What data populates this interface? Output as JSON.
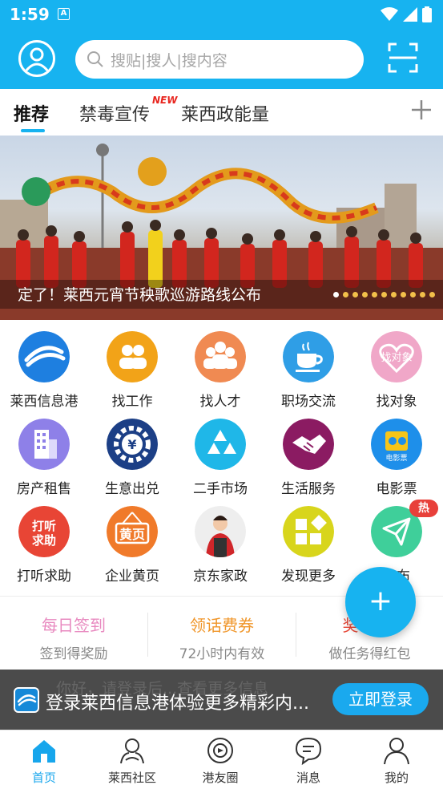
{
  "status_bar": {
    "time": "1:59",
    "notif_letter": "A"
  },
  "header": {
    "search_placeholder": "搜贴|搜人|搜内容"
  },
  "tabs": {
    "items": [
      {
        "label": "推荐"
      },
      {
        "label": "禁毒宣传"
      },
      {
        "label": "莱西政能量"
      }
    ],
    "badge": "NEW"
  },
  "banner": {
    "caption": "定了！莱西元宵节秧歌巡游路线公布",
    "dot_count": 11,
    "active_dot": 0
  },
  "grid": {
    "items": [
      {
        "label": "莱西信息港",
        "icon": "globe-logo-icon",
        "color": "#1e7fe0"
      },
      {
        "label": "找工作",
        "icon": "people-icon",
        "color": "#f2a318"
      },
      {
        "label": "找人才",
        "icon": "people-group-icon",
        "color": "#f08a52"
      },
      {
        "label": "职场交流",
        "icon": "coffee-cup-icon",
        "color": "#2f9ee6"
      },
      {
        "label": "找对象",
        "icon": "heart-icon",
        "color": "#f0a7c8"
      },
      {
        "label": "房产租售",
        "icon": "building-icon",
        "color": "#8e80e8"
      },
      {
        "label": "生意出兑",
        "icon": "money-gear-icon",
        "color": "#1c3f86"
      },
      {
        "label": "二手市场",
        "icon": "recycle-icon",
        "color": "#1fb7e8"
      },
      {
        "label": "生活服务",
        "icon": "handshake-icon",
        "color": "#8b1b62"
      },
      {
        "label": "电影票",
        "icon": "film-ticket-icon",
        "color": "#1e8fea"
      },
      {
        "label": "打听求助",
        "icon": "ask-help-icon",
        "color": "#e84535"
      },
      {
        "label": "企业黄页",
        "icon": "yellow-pages-icon",
        "color": "#f07a2a"
      },
      {
        "label": "京东家政",
        "icon": "housekeeper-photo-icon",
        "color": "#eeeeee"
      },
      {
        "label": "发现更多",
        "icon": "apps-grid-icon",
        "color": "#d8d51c"
      },
      {
        "label": "发布",
        "icon": "paper-plane-icon",
        "color": "#3fcf9a"
      }
    ],
    "hot_badge": "热"
  },
  "promo": {
    "items": [
      {
        "title": "每日签到",
        "sub": "签到得奖励",
        "color": "#e88ac0"
      },
      {
        "title": "领话费券",
        "sub": "72小时内有效",
        "color": "#f0962a"
      },
      {
        "title": "奖",
        "sub": "做任务得红包",
        "color": "#e84535"
      }
    ]
  },
  "fab": {
    "label": "+"
  },
  "login_bar": {
    "ghost_text": "你好，请登录后...查看更多信息",
    "text": "登录莱西信息港体验更多精彩内...",
    "button": "立即登录"
  },
  "bottom_nav": {
    "items": [
      {
        "label": "首页",
        "icon": "home-icon"
      },
      {
        "label": "莱西社区",
        "icon": "community-icon"
      },
      {
        "label": "港友圈",
        "icon": "circle-icon"
      },
      {
        "label": "消息",
        "icon": "message-icon"
      },
      {
        "label": "我的",
        "icon": "profile-icon"
      }
    ],
    "active_color": "#17a6ec"
  },
  "colors": {
    "accent": "#17b3f0",
    "login_bg": "#4b4b4b"
  }
}
